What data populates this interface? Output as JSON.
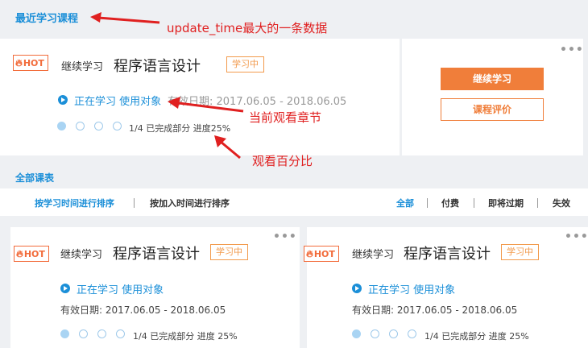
{
  "recent": {
    "title": "最近学习课程",
    "course": {
      "hot": "HOT",
      "continue_label": "继续学习",
      "name": "程序语言设计",
      "status": "学习中",
      "chapter": "正在学习 使用对象",
      "validity": "有效日期: 2017.06.05 - 2018.06.05",
      "progress_text": "1/4 已完成部分  进度25%",
      "progress": {
        "completed": 1,
        "total": 4
      },
      "more": "•••"
    },
    "actions": {
      "continue_button": "继续学习",
      "review_button": "课程评价",
      "more": "•••"
    }
  },
  "annotations": {
    "update_time": "update_time最大的一条数据",
    "chapter": "当前观看章节",
    "percent": "观看百分比"
  },
  "all_courses": {
    "title": "全部课表",
    "sort_options": [
      "按学习时间进行排序",
      "按加入时间进行排序"
    ],
    "filters": [
      "全部",
      "付费",
      "即将过期",
      "失效"
    ],
    "active_sort": 0,
    "active_filter": 0,
    "cards": [
      {
        "hot": "HOT",
        "continue_label": "继续学习",
        "name": "程序语言设计",
        "status": "学习中",
        "chapter": "正在学习 使用对象",
        "validity": "有效日期: 2017.06.05 - 2018.06.05",
        "progress_text": "1/4 已完成部分   进度 25%",
        "more": "•••"
      },
      {
        "hot": "HOT",
        "continue_label": "继续学习",
        "name": "程序语言设计",
        "status": "学习中",
        "chapter": "正在学习 使用对象",
        "validity": "有效日期: 2017.06.05 - 2018.06.05",
        "progress_text": "1/4 已完成部分   进度 25%",
        "more": "•••"
      }
    ]
  },
  "colors": {
    "accent_blue": "#1b8fd8",
    "accent_orange": "#f07e3a",
    "annotation_red": "#e02020"
  }
}
